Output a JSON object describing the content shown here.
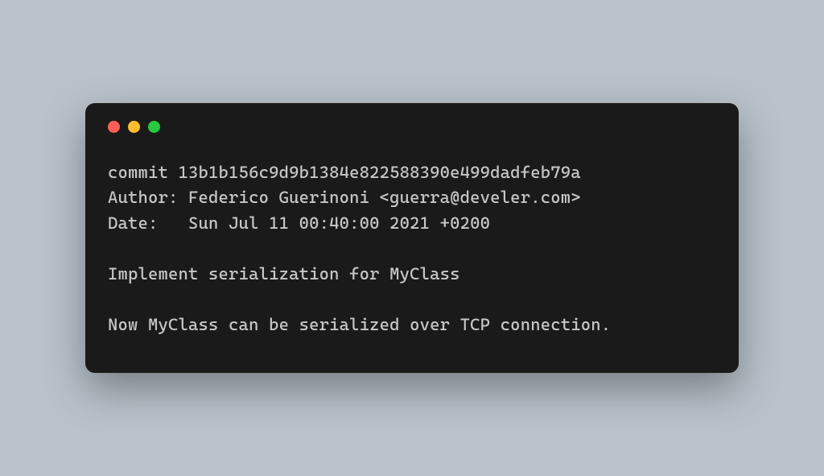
{
  "terminal": {
    "lines": [
      "commit 13b1b156c9d9b1384e822588390e499dadfeb79a",
      "Author: Federico Guerinoni <guerra@develer.com>",
      "Date:   Sun Jul 11 00:40:00 2021 +0200",
      "",
      "Implement serialization for MyClass",
      "",
      "Now MyClass can be serialized over TCP connection."
    ],
    "window_controls": {
      "close": "close",
      "minimize": "minimize",
      "zoom": "zoom"
    }
  }
}
